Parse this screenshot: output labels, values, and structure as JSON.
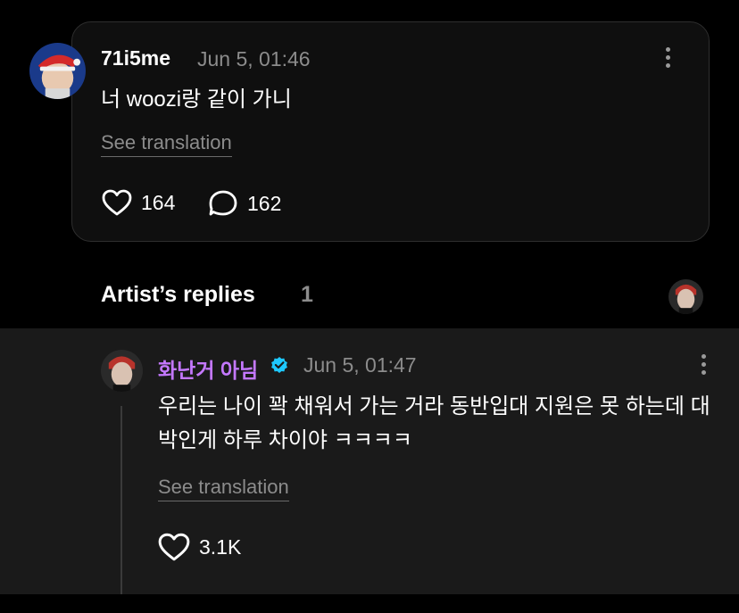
{
  "post": {
    "username": "71i5me",
    "timestamp": "Jun 5, 01:46",
    "text": "너 woozi랑 같이 가니",
    "see_translation": "See translation",
    "likes": "164",
    "comments": "162"
  },
  "artist_replies": {
    "header": "Artist’s replies",
    "count": "1"
  },
  "reply": {
    "username": "화난거 아님",
    "timestamp": "Jun 5, 01:47",
    "text": "우리는 나이 꽉 채워서 가는 거라 동반입대 지원은 못 하는데 대박인게 하루 차이야 ㅋㅋㅋㅋ",
    "see_translation": "See translation",
    "likes": "3.1K"
  },
  "colors": {
    "artist_name": "#c478ff",
    "verified_badge": "#1ec8ff",
    "muted_text": "#8c8c8c",
    "reply_bg": "#1a1a1a"
  },
  "icons": {
    "like": "heart-outline-icon",
    "comment": "speech-bubble-icon",
    "more": "vertical-ellipsis-icon",
    "verified": "verified-check-icon"
  }
}
